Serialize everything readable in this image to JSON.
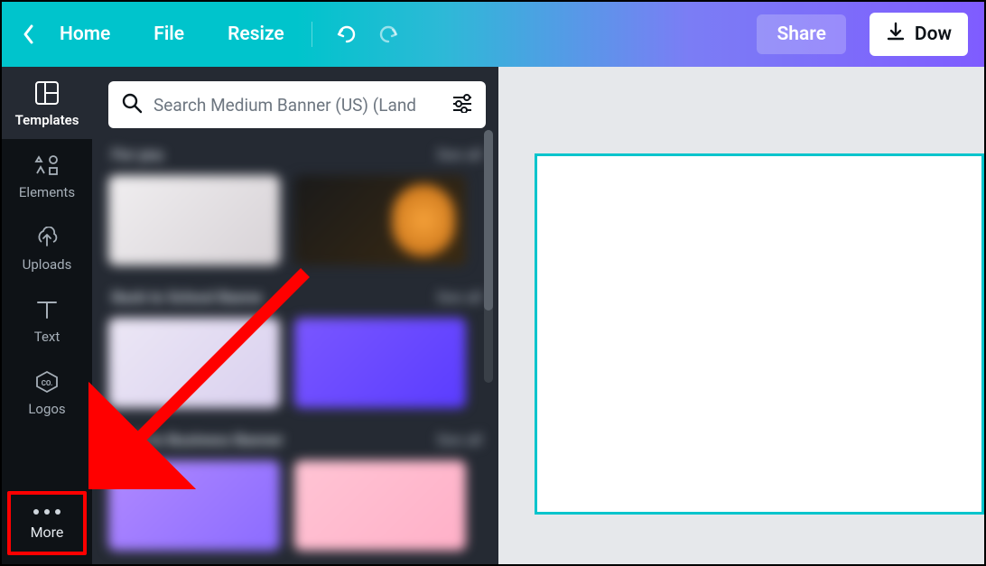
{
  "topbar": {
    "home": "Home",
    "file": "File",
    "resize": "Resize",
    "share": "Share",
    "download": "Dow"
  },
  "rail": {
    "templates": "Templates",
    "elements": "Elements",
    "uploads": "Uploads",
    "text": "Text",
    "logos": "Logos",
    "more": "More"
  },
  "search": {
    "placeholder": "Search Medium Banner (US) (Land"
  },
  "sections": {
    "s1": {
      "title": "For you",
      "more": "See all"
    },
    "s2": {
      "title": "Back to School Banne",
      "more": "See all"
    },
    "s3": {
      "title": "Back to Business Banner",
      "more": "See all"
    }
  }
}
